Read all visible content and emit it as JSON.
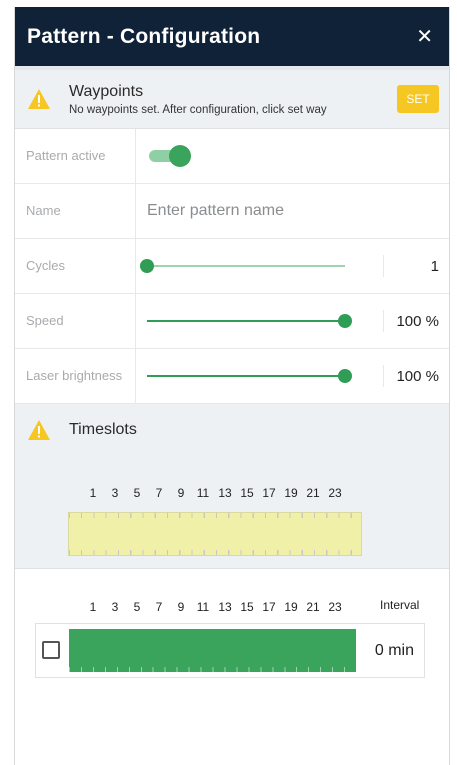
{
  "header": {
    "title": "Pattern - Configuration",
    "close_icon": "close-icon"
  },
  "waypoints": {
    "title": "Waypoints",
    "description": "No waypoints set. After configuration, click set way",
    "set_label": "SET",
    "icon": "warning-icon"
  },
  "form": {
    "pattern_active": {
      "label": "Pattern active",
      "value": true
    },
    "name": {
      "label": "Name",
      "value": "",
      "placeholder": "Enter pattern name"
    },
    "cycles": {
      "label": "Cycles",
      "value": "1",
      "fraction": 0.0
    },
    "speed": {
      "label": "Speed",
      "value": "100 %",
      "fraction": 1.0
    },
    "laser": {
      "label": "Laser brightness",
      "value": "100 %",
      "fraction": 1.0
    }
  },
  "timeslots": {
    "title": "Timeslots",
    "icon": "warning-icon",
    "hours": [
      "1",
      "3",
      "5",
      "7",
      "9",
      "11",
      "13",
      "15",
      "17",
      "19",
      "21",
      "23"
    ],
    "interval_label": "Interval",
    "interval_value": "0 min",
    "interval_checked": false
  },
  "colors": {
    "header_bg": "#0f2237",
    "accent_green": "#3aa35c",
    "warning_yellow": "#f6c623",
    "timeslot_yellow": "#f0f0a8"
  }
}
